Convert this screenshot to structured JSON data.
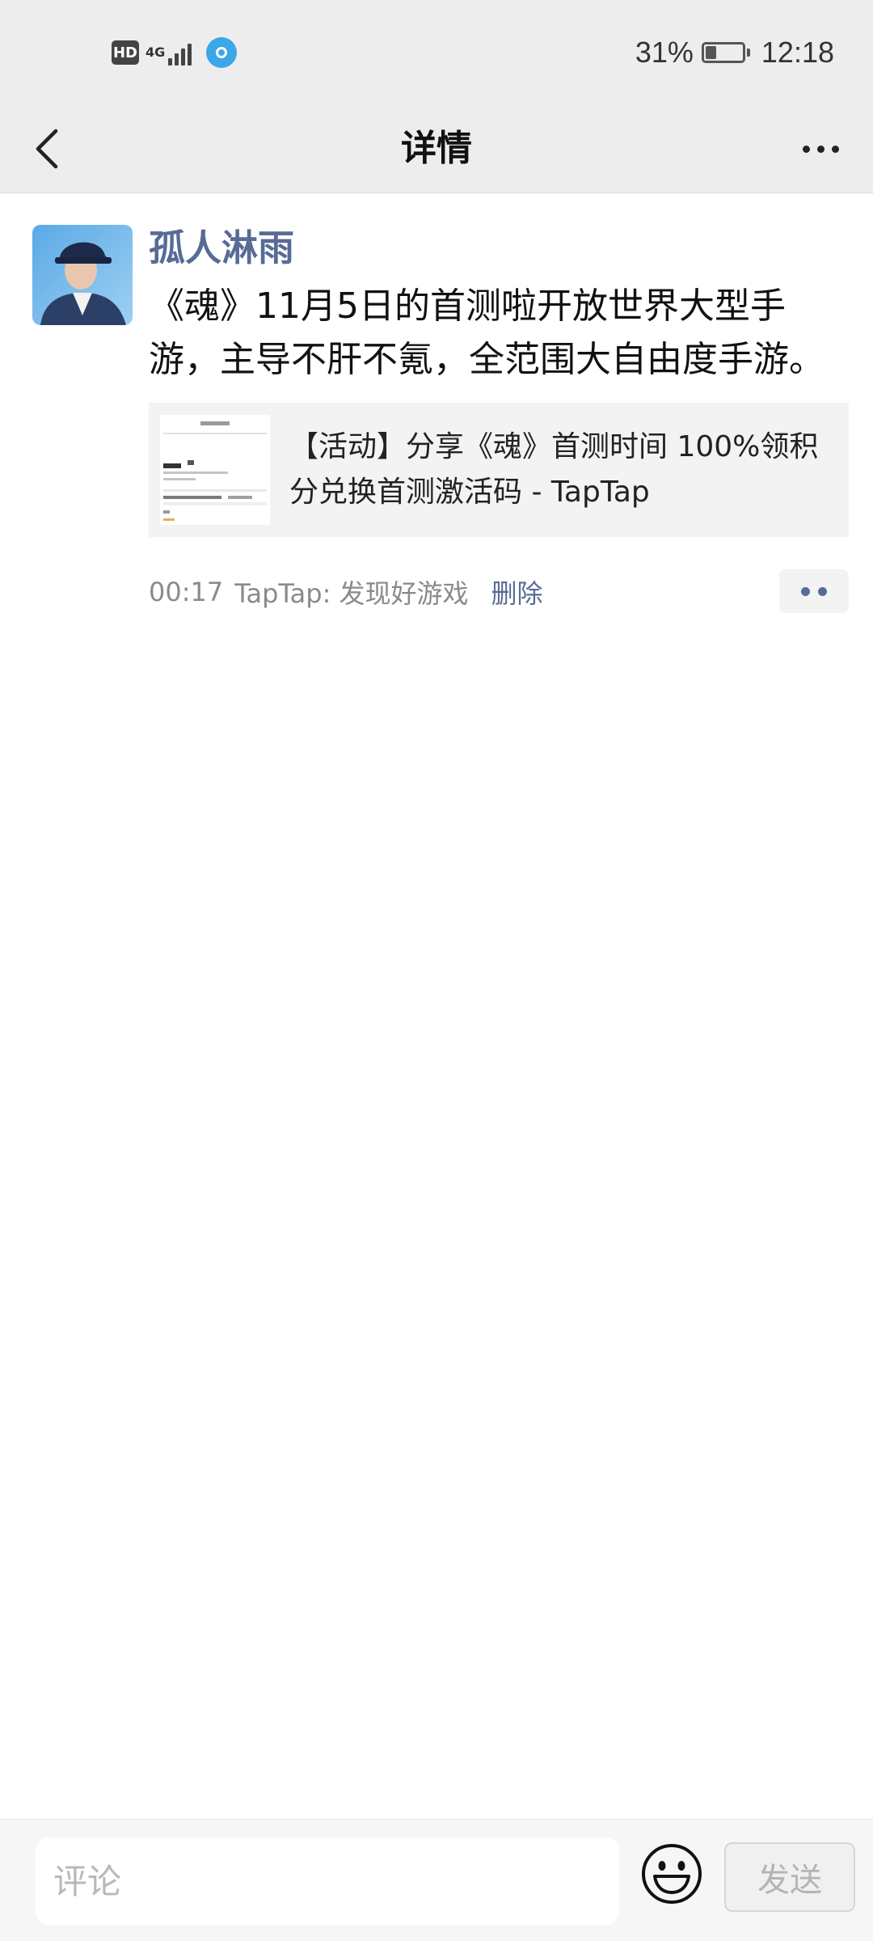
{
  "status_bar": {
    "hd": "HD",
    "network": "4G",
    "battery": "31%",
    "battery_level": 0.31,
    "time": "12:18"
  },
  "nav": {
    "title": "详情",
    "back_icon": "chevron-left-icon",
    "more_icon": "more-icon"
  },
  "post": {
    "author": "孤人淋雨",
    "text": "《魂》11月5日的首测啦开放世界大型手游，主导不肝不氪，全范围大自由度手游。",
    "link": {
      "title": "【活动】分享《魂》首测时间 100%领积分兑换首测激活码 - TapTap"
    },
    "time": "00:17",
    "source": "TapTap: 发现好游戏",
    "delete_label": "删除"
  },
  "comment_bar": {
    "placeholder": "评论",
    "send_label": "发送"
  },
  "colors": {
    "link_blue": "#576b95",
    "bar_gray": "#ededed"
  }
}
